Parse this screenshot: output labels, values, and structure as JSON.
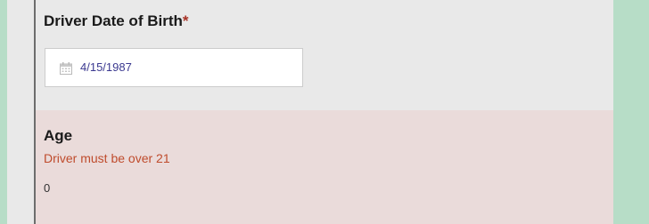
{
  "dob_field": {
    "label": "Driver Date of Birth",
    "required_marker": "*",
    "value": "4/15/1987",
    "icon": "calendar-icon"
  },
  "age_field": {
    "label": "Age",
    "error": "Driver must be over 21",
    "value": "0"
  },
  "colors": {
    "page_background": "#b7ddc7",
    "panel_background": "#e9e9e9",
    "error_section_background": "#eadbda",
    "error_text": "#bf4b2c",
    "required_star": "#a83226",
    "date_text": "#3b3990"
  }
}
